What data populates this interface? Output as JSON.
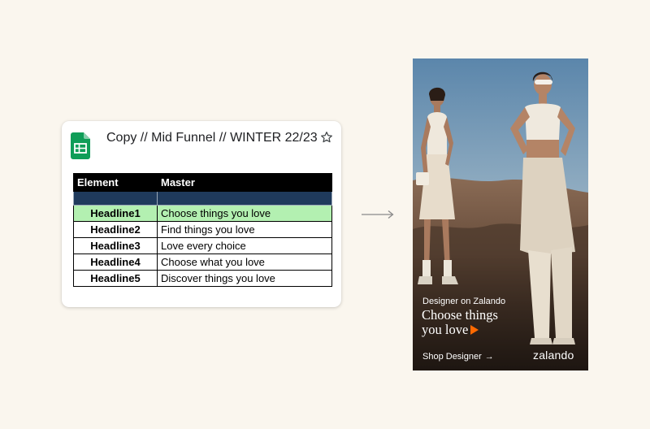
{
  "sheet": {
    "title": "Copy // Mid Funnel // WINTER 22/23",
    "columns": [
      "Element",
      "Master"
    ],
    "rows": [
      {
        "element": "Headline1",
        "master": "Choose things you love",
        "highlighted": true
      },
      {
        "element": "Headline2",
        "master": "Find things you love",
        "highlighted": false
      },
      {
        "element": "Headline3",
        "master": "Love every choice",
        "highlighted": false
      },
      {
        "element": "Headline4",
        "master": "Choose what you love",
        "highlighted": false
      },
      {
        "element": "Headline5",
        "master": "Discover things you love",
        "highlighted": false
      }
    ],
    "icon": "google-sheets-icon",
    "star_icon": "star-outline-icon"
  },
  "ad": {
    "eyebrow": "Designer on Zalando",
    "headline": "Choose things you love",
    "cta": "Shop Designer",
    "cta_icon": "arrow-right-icon",
    "brand": "zalando",
    "accent_color": "#ff6900"
  },
  "colors": {
    "page_background": "#faf6ee",
    "header_background": "#000000",
    "band_color": "#1f3a5c",
    "highlight_color": "#a8f0a6",
    "sheets_green": "#0f9d58"
  }
}
